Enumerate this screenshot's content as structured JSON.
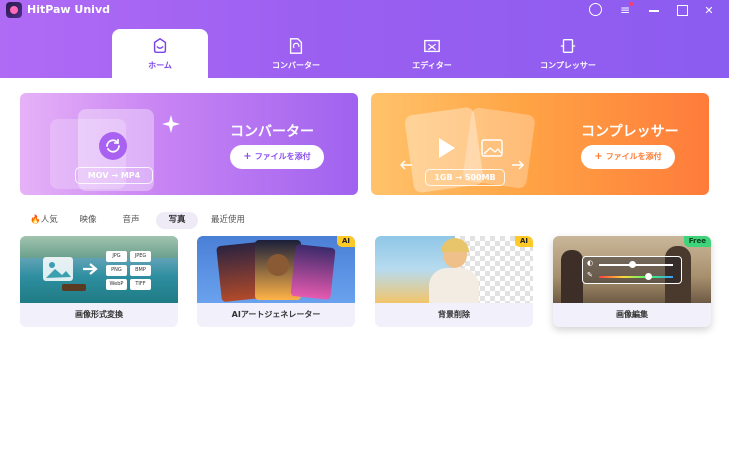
{
  "app": {
    "title": "HitPaw Univd"
  },
  "tabs": [
    {
      "label": "ホーム"
    },
    {
      "label": "コンバーター"
    },
    {
      "label": "エディター"
    },
    {
      "label": "コンプレッサー"
    }
  ],
  "features": {
    "converter": {
      "title": "コンバーター",
      "button": "ファイルを添付",
      "from": "MOV",
      "to": "MP4"
    },
    "compressor": {
      "title": "コンプレッサー",
      "button": "ファイルを添付",
      "from": "1GB",
      "to": "500MB"
    }
  },
  "subtabs": [
    {
      "label": "人気"
    },
    {
      "label": "映像"
    },
    {
      "label": "音声"
    },
    {
      "label": "写真"
    },
    {
      "label": "最近使用"
    }
  ],
  "tools": [
    {
      "label": "画像形式変換",
      "formats": [
        "JPG",
        "JPEG",
        "PNG",
        "BMP",
        "WebP",
        "TIFF"
      ]
    },
    {
      "label": "AIアートジェネレーター",
      "badge": "AI"
    },
    {
      "label": "背景削除",
      "badge": "AI"
    },
    {
      "label": "画像編集",
      "badge": "Free"
    }
  ],
  "colors": {
    "accent": "#8b5cf0",
    "orange": "#ff7b3a"
  }
}
